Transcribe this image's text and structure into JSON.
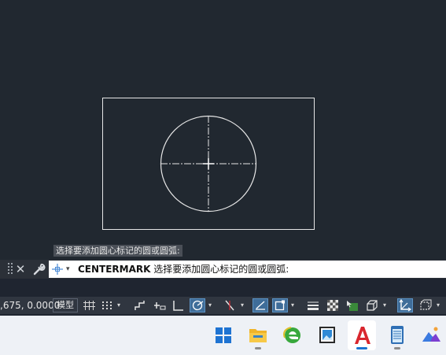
{
  "prompt_tooltip": "选择要添加圆心标记的圆或圆弧:",
  "command_line": {
    "command": "CENTERMARK",
    "prompt": "选择要添加圆心标记的圆或圆弧:",
    "close_symbol": "✕",
    "dropdown_symbol": "▾"
  },
  "status_bar": {
    "coordinates": ",675, 0.0000",
    "model_label": "模型",
    "caret_symbol": "▾"
  },
  "colors": {
    "canvas_background": "#212830",
    "drawing_lines": "#e6e6e6",
    "active_toggle": "#3f6d99",
    "autocad_red": "#d9262e",
    "taskbar_background": "#eef1f6"
  },
  "taskbar": {
    "apps": [
      {
        "name": "windows-start",
        "icon": "windows-logo-icon"
      },
      {
        "name": "file-explorer",
        "icon": "folder-icon"
      },
      {
        "name": "browser",
        "icon": "e-browser-icon"
      },
      {
        "name": "image-viewer",
        "icon": "picture-frame-icon"
      },
      {
        "name": "autocad",
        "icon": "autocad-a-icon",
        "active": true
      },
      {
        "name": "notepad",
        "icon": "notepad-icon"
      },
      {
        "name": "photos",
        "icon": "photos-mountain-icon"
      }
    ]
  }
}
